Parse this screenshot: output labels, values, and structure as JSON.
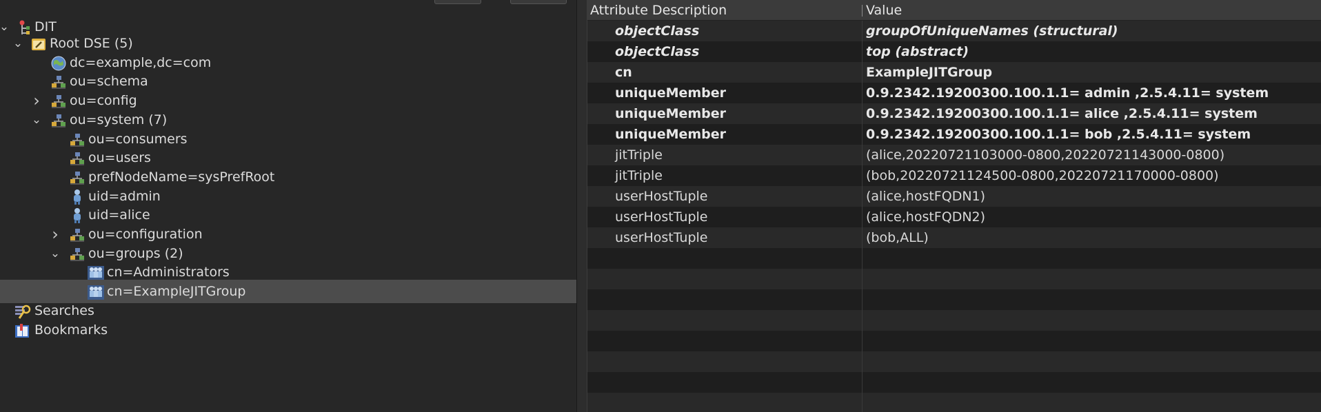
{
  "tree": {
    "root_label": "DIT",
    "nodes": [
      {
        "label": "Root DSE (5)",
        "chevron": "down",
        "icon": "root-dse-icon"
      },
      {
        "label": "dc=example,dc=com",
        "chevron": "",
        "icon": "globe-icon"
      },
      {
        "label": "ou=schema",
        "chevron": "",
        "icon": "org-unit-icon"
      },
      {
        "label": "ou=config",
        "chevron": "right",
        "icon": "org-unit-icon"
      },
      {
        "label": "ou=system (7)",
        "chevron": "down",
        "icon": "org-unit-icon"
      },
      {
        "label": "ou=consumers",
        "chevron": "",
        "icon": "org-unit-icon"
      },
      {
        "label": "ou=users",
        "chevron": "",
        "icon": "org-unit-icon"
      },
      {
        "label": "prefNodeName=sysPrefRoot",
        "chevron": "",
        "icon": "org-unit-icon"
      },
      {
        "label": "uid=admin",
        "chevron": "",
        "icon": "person-icon"
      },
      {
        "label": "uid=alice",
        "chevron": "",
        "icon": "person-icon"
      },
      {
        "label": "ou=configuration",
        "chevron": "right",
        "icon": "org-unit-icon"
      },
      {
        "label": "ou=groups (2)",
        "chevron": "down",
        "icon": "org-unit-icon"
      },
      {
        "label": "cn=Administrators",
        "chevron": "",
        "icon": "group-icon"
      },
      {
        "label": "cn=ExampleJITGroup",
        "chevron": "",
        "icon": "group-icon",
        "selected": true
      }
    ],
    "searches_label": "Searches",
    "bookmarks_label": "Bookmarks"
  },
  "table": {
    "col_attribute": "Attribute Description",
    "col_value": "Value",
    "rows": [
      {
        "name": "objectClass",
        "value": "groupOfUniqueNames (structural)",
        "style": "bold-italic"
      },
      {
        "name": "objectClass",
        "value": "top (abstract)",
        "style": "bold-italic"
      },
      {
        "name": "cn",
        "value": "ExampleJITGroup",
        "style": "bold"
      },
      {
        "name": "uniqueMember",
        "value": "0.9.2342.19200300.100.1.1= admin ,2.5.4.11= system",
        "style": "bold"
      },
      {
        "name": "uniqueMember",
        "value": "0.9.2342.19200300.100.1.1= alice ,2.5.4.11= system",
        "style": "bold"
      },
      {
        "name": "uniqueMember",
        "value": "0.9.2342.19200300.100.1.1= bob ,2.5.4.11= system",
        "style": "bold"
      },
      {
        "name": "jitTriple",
        "value": "(alice,20220721103000-0800,20220721143000-0800)",
        "style": "normal"
      },
      {
        "name": "jitTriple",
        "value": "(bob,20220721124500-0800,20220721170000-0800)",
        "style": "normal"
      },
      {
        "name": "userHostTuple",
        "value": "(alice,hostFQDN1)",
        "style": "normal"
      },
      {
        "name": "userHostTuple",
        "value": "(alice,hostFQDN2)",
        "style": "normal"
      },
      {
        "name": "userHostTuple",
        "value": "(bob,ALL)",
        "style": "normal"
      }
    ]
  },
  "colors": {
    "selected_row": "#4c4c4c",
    "tree_bg": "#272727",
    "table_bg": "#1e1e1e",
    "table_alt": "#292929"
  }
}
